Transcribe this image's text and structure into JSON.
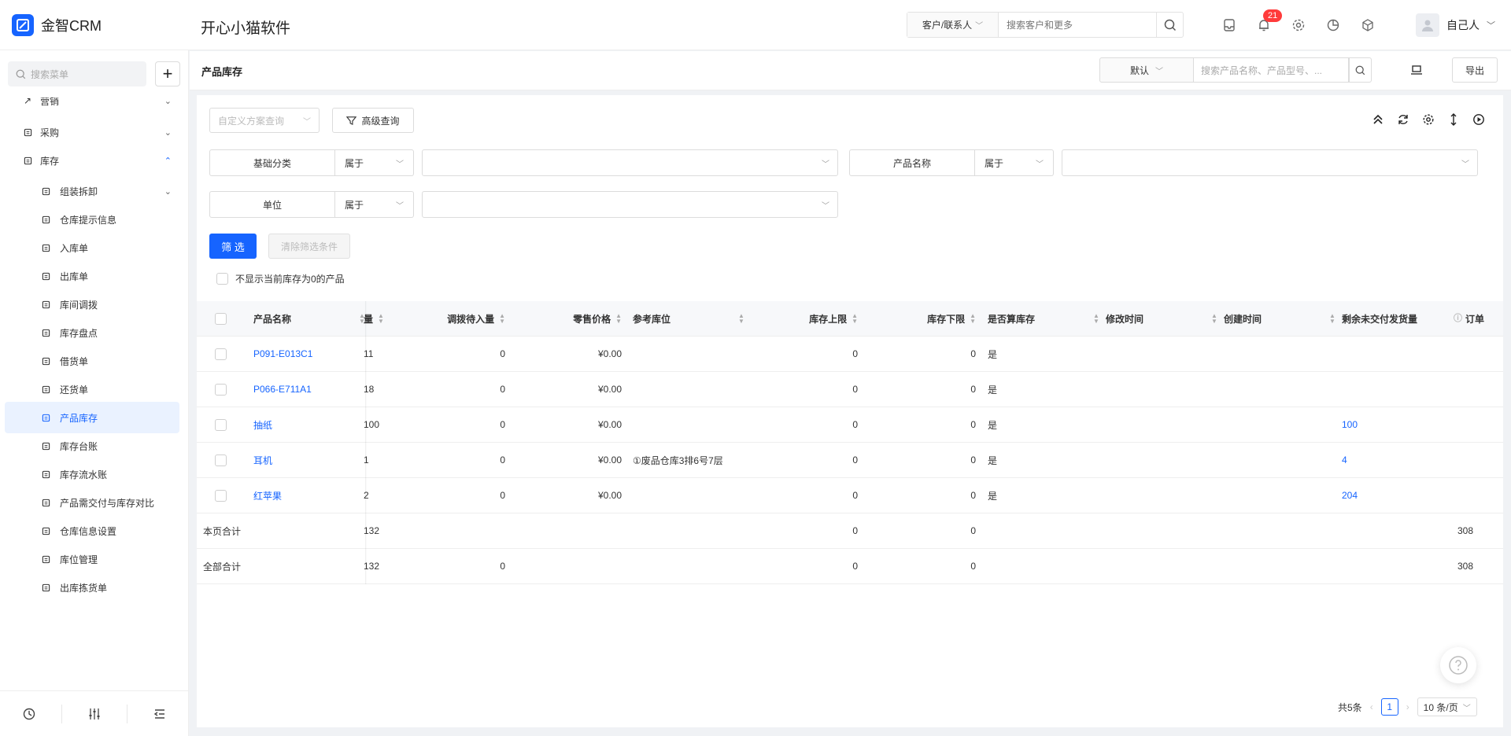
{
  "app": {
    "name": "金智CRM",
    "company": "开心小猫软件",
    "logo_icon": "logo-icon"
  },
  "global_search": {
    "type": "客户/联系人",
    "placeholder": "搜索客户和更多"
  },
  "notifications": {
    "count": "21"
  },
  "user": {
    "name": "自己人"
  },
  "sidebar": {
    "search_placeholder": "搜索菜单",
    "partial_item": "营销",
    "items": [
      {
        "label": "采购",
        "icon": "cart-icon",
        "chev": "⌄",
        "level": 1
      },
      {
        "label": "库存",
        "icon": "warehouse-icon",
        "chev": "⌃",
        "level": 1,
        "expanded": true
      },
      {
        "label": "组装拆卸",
        "icon": "assemble-icon",
        "chev": "⌄",
        "level": 2
      },
      {
        "label": "仓库提示信息",
        "icon": "info-icon",
        "level": 2
      },
      {
        "label": "入库单",
        "icon": "in-icon",
        "level": 2
      },
      {
        "label": "出库单",
        "icon": "out-icon",
        "level": 2
      },
      {
        "label": "库间调拨",
        "icon": "transfer-icon",
        "level": 2
      },
      {
        "label": "库存盘点",
        "icon": "check-icon",
        "level": 2
      },
      {
        "label": "借货单",
        "icon": "borrow-icon",
        "level": 2
      },
      {
        "label": "还货单",
        "icon": "return-icon",
        "level": 2
      },
      {
        "label": "产品库存",
        "icon": "doc-icon",
        "level": 2,
        "active": true
      },
      {
        "label": "库存台账",
        "icon": "ledger-icon",
        "level": 2
      },
      {
        "label": "库存流水账",
        "icon": "flow-icon",
        "level": 2
      },
      {
        "label": "产品需交付与库存对比",
        "icon": "compare-icon",
        "level": 2
      },
      {
        "label": "仓库信息设置",
        "icon": "gear-icon",
        "level": 2
      },
      {
        "label": "库位管理",
        "icon": "grid-icon",
        "level": 2
      },
      {
        "label": "出库拣货单",
        "icon": "pick-icon",
        "level": 2
      }
    ]
  },
  "page": {
    "title": "产品库存",
    "view_select": "默认",
    "search_placeholder": "搜索产品名称、产品型号、...",
    "export_label": "导出"
  },
  "filters": {
    "scheme_placeholder": "自定义方案查询",
    "advanced_label": "高级查询",
    "rows": [
      {
        "label": "基础分类",
        "op": "属于"
      },
      {
        "label": "产品名称",
        "op": "属于"
      },
      {
        "label": "单位",
        "op": "属于"
      }
    ],
    "submit_label": "筛 选",
    "clear_label": "清除筛选条件",
    "hide_zero_label": "不显示当前库存为0的产品"
  },
  "table": {
    "headers": [
      "产品名称",
      "量",
      "调拨待入量",
      "零售价格",
      "参考库位",
      "库存上限",
      "库存下限",
      "是否算库存",
      "修改时间",
      "创建时间",
      "剩余未交付发货量",
      "订单"
    ],
    "rows": [
      {
        "name": "P091-E013C1",
        "qty": "11",
        "transfer": "0",
        "price": "¥0.00",
        "loc": "",
        "upper": "0",
        "lower": "0",
        "counted": "是",
        "remaining": ""
      },
      {
        "name": "P066-E711A1",
        "qty": "18",
        "transfer": "0",
        "price": "¥0.00",
        "loc": "",
        "upper": "0",
        "lower": "0",
        "counted": "是",
        "remaining": ""
      },
      {
        "name": "抽纸",
        "qty": "100",
        "transfer": "0",
        "price": "¥0.00",
        "loc": "",
        "upper": "0",
        "lower": "0",
        "counted": "是",
        "remaining": "100"
      },
      {
        "name": "耳机",
        "qty": "1",
        "transfer": "0",
        "price": "¥0.00",
        "loc": "①废品仓库3排6号7层",
        "upper": "0",
        "lower": "0",
        "counted": "是",
        "remaining": "4"
      },
      {
        "name": "红苹果",
        "qty": "2",
        "transfer": "0",
        "price": "¥0.00",
        "loc": "",
        "upper": "0",
        "lower": "0",
        "counted": "是",
        "remaining": "204"
      }
    ],
    "page_total": {
      "label": "本页合计",
      "qty": "132",
      "upper": "0",
      "lower": "0",
      "order": "308"
    },
    "all_total": {
      "label": "全部合计",
      "qty": "132",
      "transfer": "0",
      "upper": "0",
      "lower": "0",
      "order": "308"
    }
  },
  "pagination": {
    "total": "共5条",
    "current": "1",
    "page_size": "10 条/页"
  },
  "colors": {
    "accent": "#1664ff",
    "badge": "#ff3b3b"
  }
}
